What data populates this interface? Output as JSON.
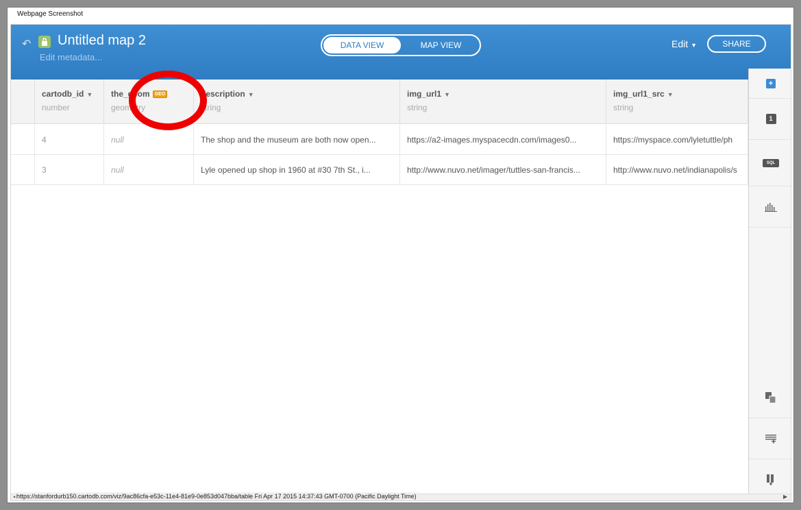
{
  "window": {
    "caption": "Webpage Screenshot"
  },
  "header": {
    "title": "Untitled map 2",
    "meta_link": "Edit metadata...",
    "tabs": [
      {
        "label": "DATA VIEW",
        "active": true
      },
      {
        "label": "MAP VIEW",
        "active": false
      }
    ],
    "edit_label": "Edit",
    "share_label": "SHARE"
  },
  "table": {
    "columns": [
      {
        "name": "cartodb_id",
        "type": "number"
      },
      {
        "name": "the_geom",
        "type": "geometry",
        "badge": "GEO"
      },
      {
        "name": "description",
        "type": "string"
      },
      {
        "name": "img_url1",
        "type": "string"
      },
      {
        "name": "img_url1_src",
        "type": "string"
      }
    ],
    "rows": [
      {
        "cartodb_id": "4",
        "the_geom": "null",
        "description": "The shop and the museum are both now open...",
        "img_url1": "https://a2-images.myspacecdn.com/images0...",
        "img_url1_src": "https://myspace.com/lyletuttle/ph"
      },
      {
        "cartodb_id": "3",
        "the_geom": "null",
        "description": "Lyle opened up shop in 1960 at #30 7th St., i...",
        "img_url1": "http://www.nuvo.net/imager/tuttles-san-francis...",
        "img_url1_src": "http://www.nuvo.net/indianapolis/s"
      }
    ]
  },
  "side_panel": {
    "one_label": "1",
    "sql_label": "SQL"
  },
  "status": {
    "url": "https://stanfordurb150.cartodb.com/viz/9ac86cfa-e53c-11e4-81e9-0e853d047bba/table Fri Apr 17 2015 14:37:43 GMT-0700 (Pacific Daylight Time)"
  },
  "colors": {
    "header_blue": "#2f7cc1",
    "geo_badge": "#f1a312",
    "highlight": "#ee0000"
  }
}
